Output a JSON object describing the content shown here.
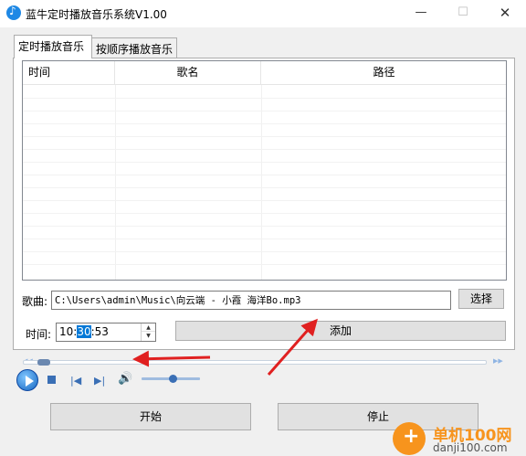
{
  "window": {
    "title": "蓝牛定时播放音乐系统V1.00",
    "min_icon": "—",
    "max_icon": "☐",
    "close_icon": "✕"
  },
  "tabs": [
    {
      "label": "定时播放音乐",
      "active": true
    },
    {
      "label": "按顺序播放音乐",
      "active": false
    }
  ],
  "list": {
    "columns": [
      "时间",
      "歌名",
      "路径"
    ],
    "rows": []
  },
  "song": {
    "label": "歌曲:",
    "value": "C:\\Users\\admin\\Music\\向云端 - 小霞 海洋Bo.mp3",
    "choose_label": "选择"
  },
  "time": {
    "label": "时间:",
    "hour": "10",
    "minute": "30",
    "second": "53"
  },
  "add_label": "添加",
  "player": {
    "seek_progress": 0.03,
    "volume": 0.5
  },
  "start_label": "开始",
  "stop_label": "停止",
  "watermark": {
    "name": "单机100网",
    "url": "danji100.com"
  },
  "colors": {
    "accent": "#0078d7",
    "annotation_arrow": "#e02020",
    "watermark": "#f7941d"
  }
}
